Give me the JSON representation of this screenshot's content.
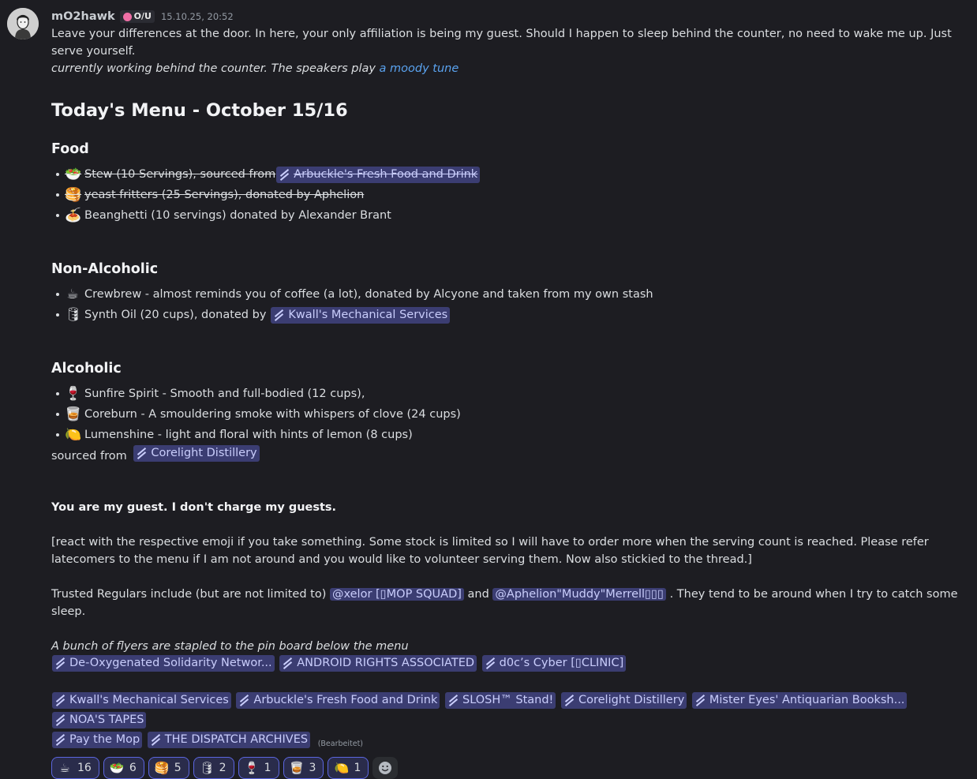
{
  "author": {
    "name": "mO2hawk",
    "tag": "O/U",
    "timestamp": "15.10.25, 20:52"
  },
  "intro": {
    "line1": "Leave your differences at the door. In here, your only affiliation is being my guest. Should I happen to sleep behind the counter, no need to wake me up. Just serve yourself.",
    "line2": "currently working behind the counter. The speakers play ",
    "link": "a moody tune"
  },
  "menu_title": "Today's Menu - October 15/16",
  "food": {
    "heading": "Food",
    "items": [
      {
        "icon": "🥗",
        "pre": "Stew (10 Servings), sourced from ",
        "channel": "Arbuckle's Fresh Food and Drink",
        "post": ""
      },
      {
        "icon": "🥞",
        "pre": "yeast fritters (25 Servings), donated by Aphelion",
        "channel": "",
        "post": ""
      },
      {
        "icon": "🍝",
        "pre": "Beanghetti (10 servings) donated by Alexander Brant",
        "channel": "",
        "post": ""
      }
    ]
  },
  "nonalc": {
    "heading": "Non-Alcoholic",
    "items": [
      {
        "icon": "☕",
        "pre": "Crewbrew - almost reminds you of coffee (a lot), donated by Alcyone and taken from my own stash",
        "channel": ""
      },
      {
        "icon": "🛢",
        "pre": "Synth Oil (20 cups), donated by ",
        "channel": "Kwall's Mechanical Services"
      }
    ]
  },
  "alc": {
    "heading": "Alcoholic",
    "items": [
      {
        "icon": "🍷",
        "pre": "Sunfire Spirit -  Smooth and full-bodied (12 cups),"
      },
      {
        "icon": "🥃",
        "pre": "Coreburn - A smouldering smoke with whispers of clove (24 cups)"
      },
      {
        "icon": "🍋",
        "pre": "Lumenshine - light and floral with hints of lemon (8 cups)"
      }
    ],
    "sourced_pre": "sourced from ",
    "sourced_channel": "Corelight Distillery"
  },
  "guest_line": "You are my guest. I don't charge my guests.",
  "react_note": "[react with the respective emoji if you take something. Some stock is limited so I will have to order more when the serving count is reached. Please refer latecomers to the menu if I am not around and you would like to volunteer serving them. Now also stickied to the thread.]",
  "regulars": {
    "pre": "Trusted Regulars include (but are not limited to) ",
    "mention1": "@xelor [▯MOP SQUAD]",
    "mid": " and ",
    "mention2": "@Aphelion\"Muddy\"Merrell▯▯▯",
    "post": " . They tend to be around when I try to catch some sleep."
  },
  "flyers_note": "A bunch of flyers are stapled to the pin board below the menu",
  "flyers_row1": [
    "De-Oxygenated Solidarity Networ...",
    "ANDROID RIGHTS ASSOCIATED",
    "d0c’s Cyber [▯CLINIC]"
  ],
  "flyers_row2": [
    "Kwall's Mechanical Services",
    "Arbuckle's Fresh Food and Drink",
    "SLOSH™ Stand!",
    "Corelight Distillery",
    "Mister Eyes' Antiquarian Booksh...",
    "NOA'S TAPES"
  ],
  "flyers_row3": [
    "Pay the Mop",
    "THE DISPATCH ARCHIVES"
  ],
  "edited": "(Bearbeitet)",
  "reactions": [
    {
      "icon": "☕",
      "count": "16"
    },
    {
      "icon": "🥗",
      "count": "6"
    },
    {
      "icon": "🥞",
      "count": "5"
    },
    {
      "icon": "🛢",
      "count": "2"
    },
    {
      "icon": "🍷",
      "count": "1"
    },
    {
      "icon": "🥃",
      "count": "3"
    },
    {
      "icon": "🍋",
      "count": "1"
    }
  ],
  "colors": {
    "background": "#1d1d22",
    "mention_bg": "#3b3d72",
    "mention_fg": "#c9cdfb",
    "link": "#5aa3f0",
    "reaction_border": "#5b66e0"
  }
}
